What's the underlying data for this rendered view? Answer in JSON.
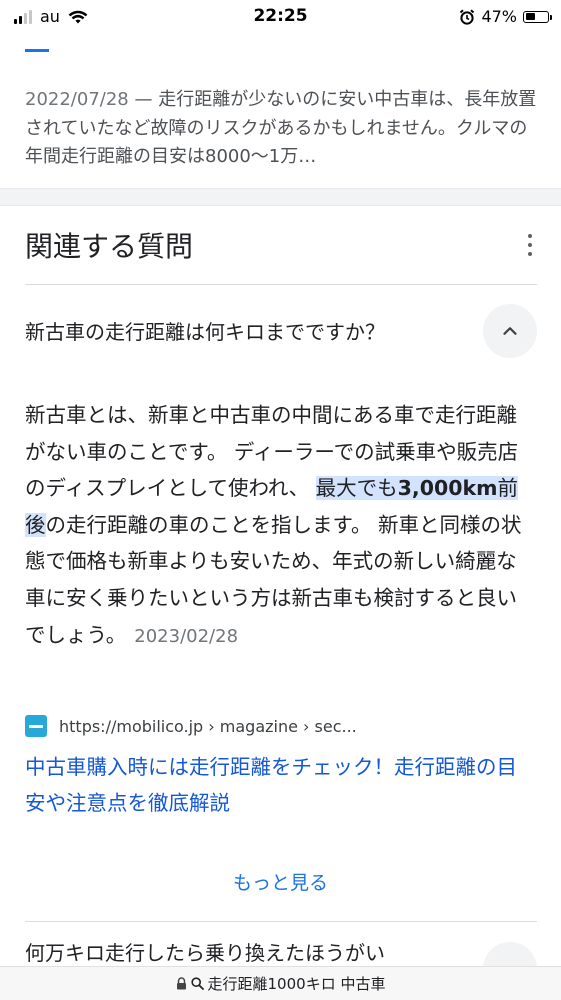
{
  "status_bar": {
    "carrier": "au",
    "time": "22:25",
    "battery_percent_label": "47%",
    "battery_level": 0.47
  },
  "previous_result": {
    "date": "2022/07/28",
    "separator": " — ",
    "snippet": "走行距離が少ないのに安い中古車は、長年放置されていたなど故障のリスクがあるかもしれません。クルマの年間走行距離の目安は8000〜1万…"
  },
  "related_questions": {
    "title": "関連する質問",
    "expanded": {
      "question": "新古車の走行距離は何キロまでですか？",
      "answer_before": "新古車とは、新車と中古車の中間にある車で走行距離がない車のことです。 ディーラーでの試乗車や販売店のディスプレイとして使われ、 ",
      "answer_highlight_pre": "最大でも",
      "answer_highlight_bold": "3,000km",
      "answer_highlight_post": "前後",
      "answer_after": "の走行距離の車のことを指します。 新車と同様の状態で価格も新車よりも安いため、年式の新しい綺麗な車に安く乗りたいという方は新古車も検討すると良いでしょう。",
      "answer_date": "2023/02/28",
      "source_url": "https://mobilico.jp › magazine › sec...",
      "result_title": "中古車購入時には走行距離をチェック！走行距離の目安や注意点を徹底解説",
      "more_label": "もっと見る"
    },
    "next_question": "何万キロ走行したら乗り換えたほうがい"
  },
  "url_bar": {
    "query": "走行距離1000キロ 中古車"
  },
  "colors": {
    "link_blue": "#1558d6",
    "accent_blue": "#1a73e8",
    "highlight": "#d3e3fd"
  }
}
